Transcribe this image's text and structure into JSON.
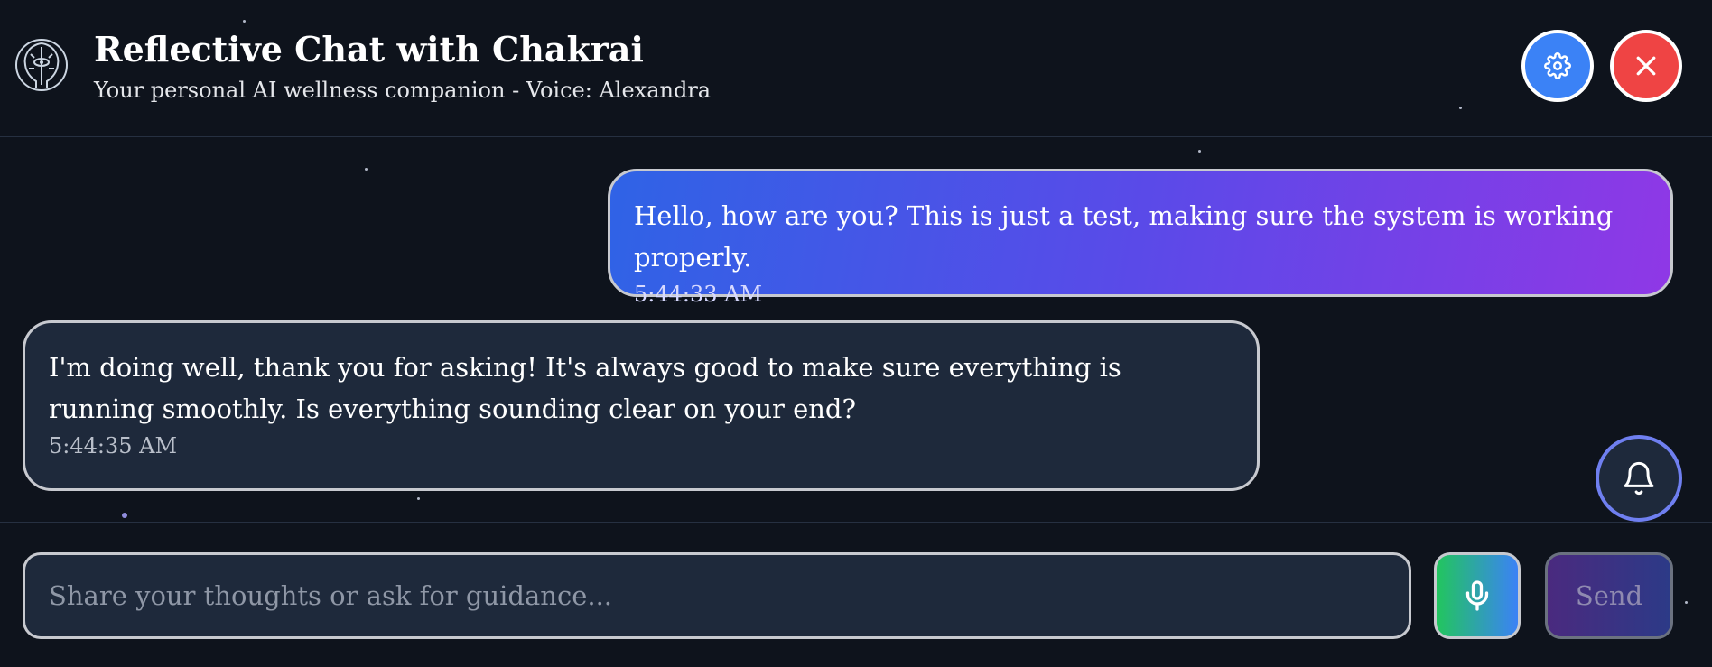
{
  "header": {
    "title": "Reflective Chat with Chakrai",
    "subtitle": "Your personal AI wellness companion - Voice: Alexandra",
    "logo_icon": "meditating-head-logo-icon",
    "settings_icon": "gear-icon",
    "close_icon": "close-icon"
  },
  "messages": [
    {
      "role": "user",
      "text": "Hello, how are you? This is just a test, making sure the system is working properly.",
      "time": "5:44:33 AM"
    },
    {
      "role": "assistant",
      "text": "I'm doing well, thank you for asking! It's always good to make sure everything is running smoothly. Is everything sounding clear on your end?",
      "time": "5:44:35 AM"
    }
  ],
  "notification": {
    "icon": "bell-icon"
  },
  "composer": {
    "placeholder": "Share your thoughts or ask for guidance...",
    "value": "",
    "mic_icon": "microphone-icon",
    "send_label": "Send"
  },
  "colors": {
    "background": "#0e131c",
    "user_bubble_start": "#2f63e6",
    "user_bubble_end": "#8f38e6",
    "assistant_bubble": "#1e293b",
    "settings_button": "#3b82f6",
    "close_button": "#ef4444"
  }
}
